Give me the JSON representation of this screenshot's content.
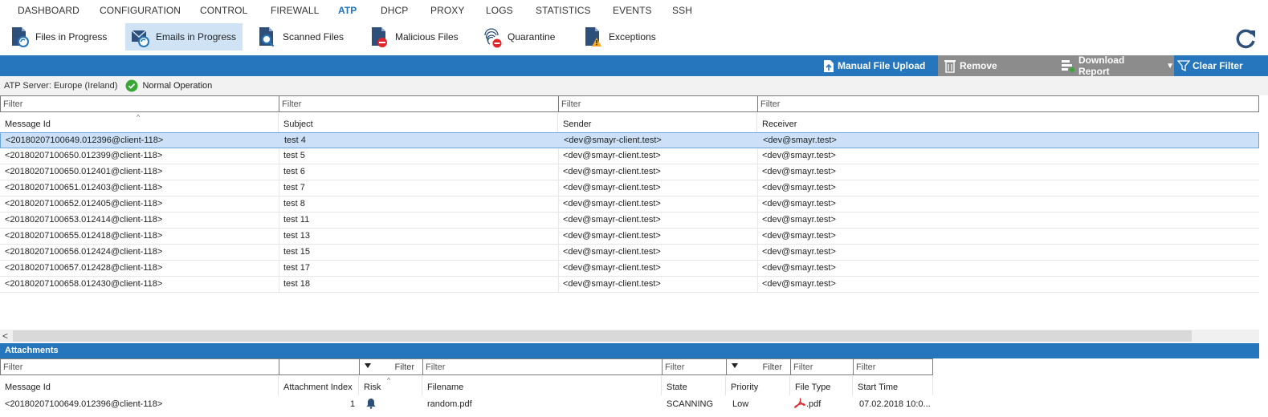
{
  "nav": {
    "items": [
      "DASHBOARD",
      "CONFIGURATION",
      "CONTROL",
      "FIREWALL",
      "ATP",
      "DHCP",
      "PROXY",
      "LOGS",
      "STATISTICS",
      "EVENTS",
      "SSH"
    ],
    "active": "ATP"
  },
  "toolbar": {
    "buttons": [
      {
        "label": "Files in Progress",
        "icon": "files-progress-icon"
      },
      {
        "label": "Emails in Progress",
        "icon": "emails-progress-icon",
        "active": true
      },
      {
        "label": "Scanned Files",
        "icon": "scanned-files-icon"
      },
      {
        "label": "Malicious Files",
        "icon": "malicious-files-icon"
      },
      {
        "label": "Quarantine",
        "icon": "quarantine-fingerprint-icon"
      },
      {
        "label": "Exceptions",
        "icon": "exceptions-warning-icon"
      }
    ],
    "refresh_icon": "refresh-icon"
  },
  "actions": {
    "upload": "Manual File Upload",
    "remove": "Remove",
    "download": "Download Report",
    "clear": "Clear Filter"
  },
  "status": {
    "server": "ATP Server: Europe (Ireland)",
    "state": "Normal Operation"
  },
  "main_grid": {
    "filter_placeholder": "Filter",
    "columns": [
      "Message Id",
      "Subject",
      "Sender",
      "Receiver"
    ],
    "rows": [
      [
        "<20180207100649.012396@client-118>",
        "test 4",
        "<dev@smayr-client.test>",
        "<dev@smayr.test>"
      ],
      [
        "<20180207100650.012399@client-118>",
        "test 5",
        "<dev@smayr-client.test>",
        "<dev@smayr.test>"
      ],
      [
        "<20180207100650.012401@client-118>",
        "test 6",
        "<dev@smayr-client.test>",
        "<dev@smayr.test>"
      ],
      [
        "<20180207100651.012403@client-118>",
        "test 7",
        "<dev@smayr-client.test>",
        "<dev@smayr.test>"
      ],
      [
        "<20180207100652.012405@client-118>",
        "test 8",
        "<dev@smayr-client.test>",
        "<dev@smayr.test>"
      ],
      [
        "<20180207100653.012414@client-118>",
        "test 11",
        "<dev@smayr-client.test>",
        "<dev@smayr.test>"
      ],
      [
        "<20180207100655.012418@client-118>",
        "test 13",
        "<dev@smayr-client.test>",
        "<dev@smayr.test>"
      ],
      [
        "<20180207100656.012424@client-118>",
        "test 15",
        "<dev@smayr-client.test>",
        "<dev@smayr.test>"
      ],
      [
        "<20180207100657.012428@client-118>",
        "test 17",
        "<dev@smayr-client.test>",
        "<dev@smayr.test>"
      ],
      [
        "<20180207100658.012430@client-118>",
        "test 18",
        "<dev@smayr-client.test>",
        "<dev@smayr.test>"
      ]
    ],
    "selected_row": 0
  },
  "attachments": {
    "title": "Attachments",
    "filter_placeholder": "Filter",
    "columns": [
      "Message Id",
      "Attachment Index",
      "Risk",
      "Filename",
      "State",
      "Priority",
      "File Type",
      "Start Time"
    ],
    "rows": [
      {
        "message_id": "<20180207100649.012396@client-118>",
        "index": "1",
        "risk_icon": "risk-pending-icon",
        "filename": "random.pdf",
        "state": "SCANNING",
        "priority": "Low",
        "file_type": ".pdf",
        "file_type_icon": "pdf-icon",
        "start_time": "07.02.2018 10:0..."
      }
    ]
  },
  "colors": {
    "accent": "#2676bd",
    "selected": "#cce1f7",
    "grey_button": "#8c8c8c",
    "ok_green": "#3aa635"
  }
}
